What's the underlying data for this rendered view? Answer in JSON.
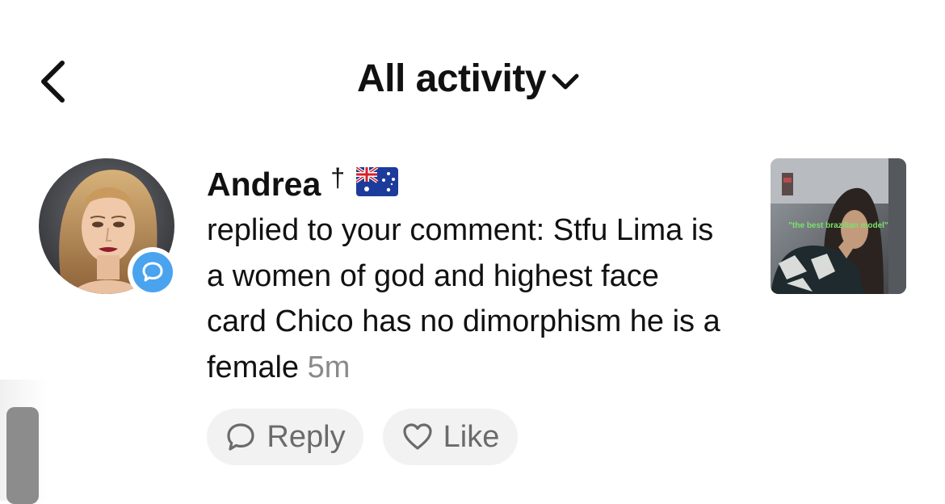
{
  "header": {
    "title": "All activity"
  },
  "notification": {
    "username": "Andrea",
    "dagger": "†",
    "message_prefix": "replied to your comment: Stfu Lima is a women of god and highest face card Chico has no dimorphism he is a female",
    "timestamp": "5m",
    "thumbnail_caption": "\"the best brazilian model\""
  },
  "actions": {
    "reply_label": "Reply",
    "like_label": "Like"
  },
  "icons": {
    "back": "chevron-left-icon",
    "title_dropdown": "chevron-down-icon",
    "comment_badge": "comment-bubble-icon",
    "reply": "speech-bubble-icon",
    "like": "heart-icon",
    "flag": "australia-flag-icon"
  },
  "colors": {
    "badge": "#4aa3ef",
    "pill_bg": "#f2f2f2",
    "muted_text": "#8a8a8a"
  }
}
